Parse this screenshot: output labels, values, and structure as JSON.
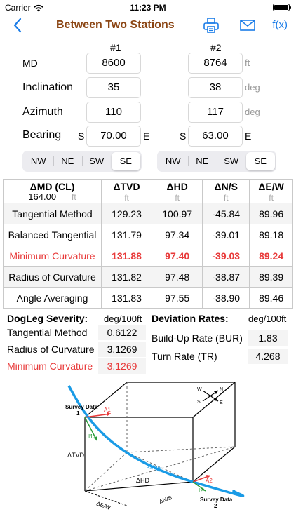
{
  "status": {
    "carrier": "Carrier",
    "time": "11:23 PM"
  },
  "nav": {
    "title": "Between Two Stations",
    "fx_label": "f(x)"
  },
  "columns": {
    "station1": "#1",
    "station2": "#2"
  },
  "rows": {
    "md": {
      "label": "MD",
      "v1": "8600",
      "v2": "8764",
      "unit": "ft"
    },
    "inclination": {
      "label": "Inclination",
      "v1": "35",
      "v2": "38",
      "unit": "deg"
    },
    "azimuth": {
      "label": "Azimuth",
      "v1": "110",
      "v2": "117",
      "unit": "deg"
    },
    "bearing": {
      "label": "Bearing",
      "pre1": "S",
      "v1": "70.00",
      "post1": "E",
      "pre2": "S",
      "v2": "63.00",
      "post2": "E"
    }
  },
  "quadrants": {
    "options": [
      "NW",
      "NE",
      "SW",
      "SE"
    ],
    "selected1": "SE",
    "selected2": "SE"
  },
  "results": {
    "headers": {
      "md_cl": "ΔMD (CL)",
      "md_cl_value": "164.00",
      "tvd": "ΔTVD",
      "hd": "ΔHD",
      "ns": "ΔN/S",
      "ew": "ΔE/W",
      "unit": "ft"
    },
    "rows": [
      {
        "name": "Tangential Method",
        "tvd": "129.23",
        "hd": "100.97",
        "ns": "-45.84",
        "ew": "89.96"
      },
      {
        "name": "Balanced Tangential",
        "tvd": "131.79",
        "hd": "97.34",
        "ns": "-39.01",
        "ew": "89.18"
      },
      {
        "name": "Minimum Curvature",
        "tvd": "131.88",
        "hd": "97.40",
        "ns": "-39.03",
        "ew": "89.24"
      },
      {
        "name": "Radius of Curvature",
        "tvd": "131.82",
        "hd": "97.48",
        "ns": "-38.87",
        "ew": "89.39"
      },
      {
        "name": "Angle Averaging",
        "tvd": "131.83",
        "hd": "97.55",
        "ns": "-38.90",
        "ew": "89.46"
      }
    ]
  },
  "dogleg": {
    "title": "DogLeg Severity:",
    "unit": "deg/100ft",
    "items": [
      {
        "label": "Tangential Method",
        "value": "0.6122"
      },
      {
        "label": "Radius of Curvature",
        "value": "3.1269"
      },
      {
        "label": "Minimum Curvature",
        "value": "3.1269"
      }
    ]
  },
  "deviation": {
    "title": "Deviation Rates:",
    "unit": "deg/100ft",
    "items": [
      {
        "label": "Build-Up Rate (BUR)",
        "value": "1.83"
      },
      {
        "label": "Turn Rate (TR)",
        "value": "4.268"
      }
    ]
  },
  "diagram": {
    "survey1_line1": "Survey Data",
    "survey1_line2": "1",
    "survey2_line1": "Survey Data",
    "survey2_line2": "2",
    "a1": "A1",
    "i1": "I1",
    "a2": "A2",
    "i2": "I2",
    "tvd": "ΔTVD",
    "md": "ΔMD",
    "hd": "ΔHD",
    "ew": "ΔE/W",
    "ns": "ΔN/S",
    "compass_w": "W",
    "compass_n": "N",
    "compass_s": "S",
    "compass_e": "E",
    "colors": {
      "curve": "#1a9be6",
      "accent": "#e83a3a",
      "green": "#2a9d3a"
    }
  }
}
